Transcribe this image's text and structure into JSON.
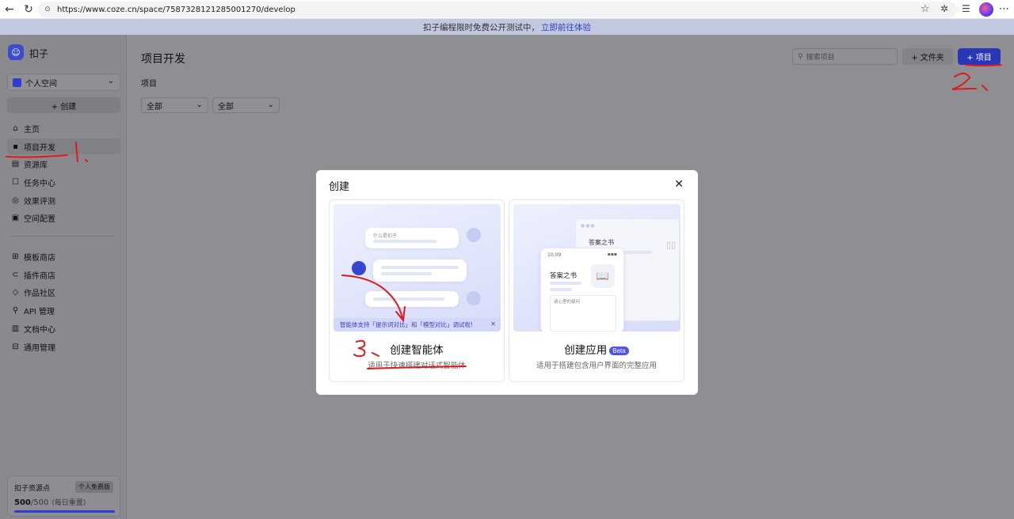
{
  "browser": {
    "url": "https://www.coze.cn/space/7587328121285001270/develop"
  },
  "banner": {
    "text": "扣子编程限时免费公开测试中，",
    "link": "立即前往体验"
  },
  "sidebar": {
    "brand": "扣子",
    "space": "个人空间",
    "create": "+ 创建",
    "items": [
      {
        "label": "主页",
        "icon": "home-icon"
      },
      {
        "label": "项目开发",
        "icon": "project-icon"
      },
      {
        "label": "资源库",
        "icon": "library-icon"
      },
      {
        "label": "任务中心",
        "icon": "task-icon"
      },
      {
        "label": "效果评测",
        "icon": "eval-icon"
      },
      {
        "label": "空间配置",
        "icon": "config-icon"
      }
    ],
    "items2": [
      {
        "label": "模板商店",
        "icon": "template-icon"
      },
      {
        "label": "插件商店",
        "icon": "plugin-icon"
      },
      {
        "label": "作品社区",
        "icon": "community-icon"
      },
      {
        "label": "API 管理",
        "icon": "api-icon"
      },
      {
        "label": "文档中心",
        "icon": "doc-icon"
      },
      {
        "label": "通用管理",
        "icon": "manage-icon"
      }
    ],
    "resource": {
      "title": "扣子资源点",
      "plan": "个人免费版",
      "used": "500",
      "total": "/500",
      "reset": "(每日重置)"
    }
  },
  "main": {
    "title": "项目开发",
    "subtitle": "项目",
    "filter1": "全部",
    "filter2": "全部",
    "search_placeholder": "搜索项目",
    "folder_button": "+ 文件夹",
    "project_button": "+ 项目"
  },
  "modal": {
    "title": "创建",
    "card1": {
      "name": "创建智能体",
      "desc": "适用于快速搭建对话式智能体",
      "chat_hint": "什么是扣子",
      "tip": "智能体支持「提示词对比」和「模型对比」调试啦!"
    },
    "card2": {
      "name": "创建应用",
      "badge": "Beta",
      "desc": "适用于搭建包含用户界面的完整应用",
      "window_title": "答案之书",
      "phone_title": "答案之书",
      "phone_time": "10:09",
      "phone_input": "请心里的疑问"
    }
  },
  "annotations": [
    "1.",
    "2.",
    "3."
  ],
  "colors": {
    "accent": "#4d53e8",
    "overlay": "#8f8f93",
    "annotation": "#e01919"
  }
}
